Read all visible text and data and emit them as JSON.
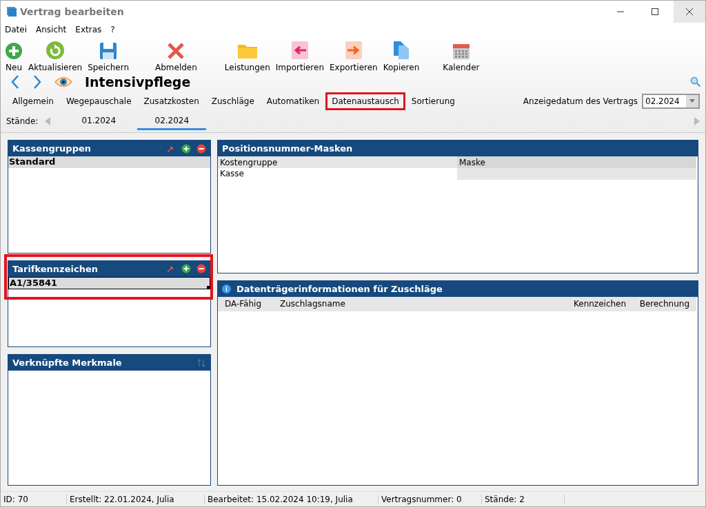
{
  "window": {
    "title": "Vertrag bearbeiten"
  },
  "menu": [
    "Datei",
    "Ansicht",
    "Extras",
    "?"
  ],
  "toolbar": [
    {
      "label": "Neu",
      "kind": "add"
    },
    {
      "label": "Aktualisieren",
      "kind": "refresh"
    },
    {
      "label": "Speichern",
      "kind": "save"
    },
    {
      "label": "Abmelden",
      "kind": "cancel"
    },
    {
      "label": "Leistungen",
      "kind": "folder"
    },
    {
      "label": "Importieren",
      "kind": "import"
    },
    {
      "label": "Exportieren",
      "kind": "export"
    },
    {
      "label": "Kopieren",
      "kind": "copy"
    },
    {
      "label": "Kalender",
      "kind": "calendar"
    }
  ],
  "heading": {
    "title": "Intensivpflege"
  },
  "tabs": [
    {
      "label": "Allgemein",
      "highlighted": false
    },
    {
      "label": "Wegepauschale",
      "highlighted": false
    },
    {
      "label": "Zusatzkosten",
      "highlighted": false
    },
    {
      "label": "Zuschläge",
      "highlighted": false
    },
    {
      "label": "Automatiken",
      "highlighted": false
    },
    {
      "label": "Datenaustausch",
      "highlighted": true
    },
    {
      "label": "Sortierung",
      "highlighted": false
    }
  ],
  "date_picker": {
    "label": "Anzeigedatum des Vertrags",
    "value": "02.2024"
  },
  "staende": {
    "label": "Stände:",
    "items": [
      {
        "label": "01.2024",
        "selected": false
      },
      {
        "label": "02.2024",
        "selected": true
      }
    ]
  },
  "left_panels": [
    {
      "title": "Kassengruppen",
      "kind": "edit",
      "highlighted": false,
      "rows": [
        {
          "text": "Standard",
          "selected": true,
          "focused": false
        }
      ]
    },
    {
      "title": "Tarifkennzeichen",
      "kind": "edit",
      "highlighted": true,
      "rows": [
        {
          "text": "A1/35841",
          "selected": true,
          "focused": true
        }
      ]
    },
    {
      "title": "Verknüpfte Merkmale",
      "kind": "sort",
      "highlighted": false
    }
  ],
  "masks": {
    "title": "Positionsnummer-Masken",
    "columns": [
      "Kostengruppe",
      "Maske"
    ],
    "rows": [
      [
        "Kasse"
      ]
    ]
  },
  "carrier_info": {
    "title": "Datenträgerinformationen für Zuschläge",
    "columns": [
      "DA-Fähig",
      "Zuschlagsname",
      "Kennzeichen",
      "Berechnung"
    ]
  },
  "status_bar": [
    "ID: 70",
    "Erstellt: 22.01.2024, Julia",
    "Bearbeitet: 15.02.2024 10:19, Julia",
    "Vertragsnummer: 0",
    "Stände: 2"
  ]
}
